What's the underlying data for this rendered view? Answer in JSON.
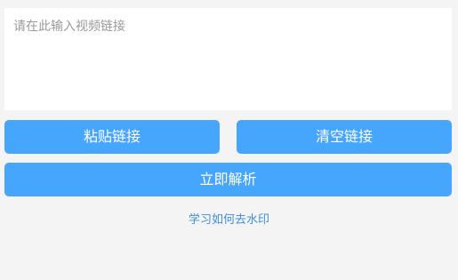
{
  "link_input": {
    "value": "",
    "placeholder": "请在此输入视频链接"
  },
  "actions": {
    "paste_label": "粘贴链接",
    "clear_label": "清空链接",
    "parse_label": "立即解析"
  },
  "help": {
    "link_label": "学习如何去水印"
  },
  "colors": {
    "accent": "#46a6fb",
    "link": "#3d8fe0",
    "background": "#f4f4f4"
  }
}
